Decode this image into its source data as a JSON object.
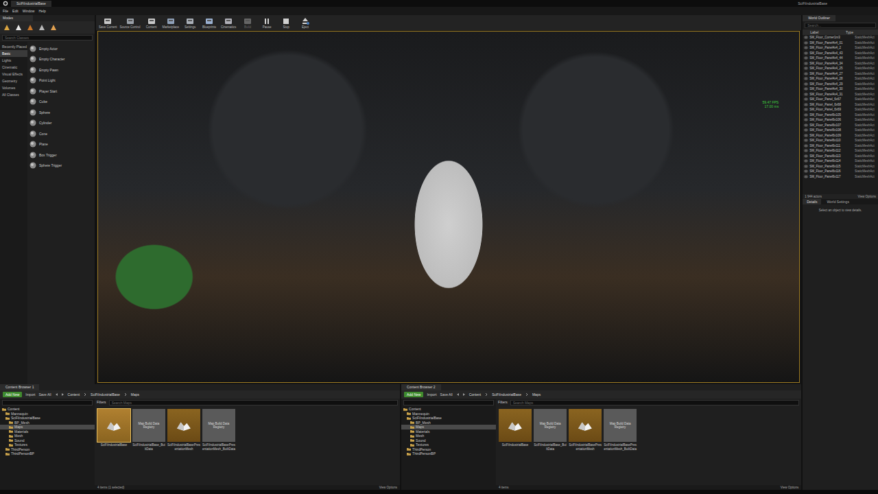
{
  "window": {
    "tab": "SciFiIndustrialBase",
    "project": "SciFiIndustrialBase"
  },
  "menu": [
    "File",
    "Edit",
    "Window",
    "Help"
  ],
  "modes": {
    "tab": "Modes",
    "search_placeholder": "Search Classes",
    "categories": [
      {
        "label": "Recently Placed",
        "selected": false
      },
      {
        "label": "Basic",
        "selected": true
      },
      {
        "label": "Lights",
        "selected": false
      },
      {
        "label": "Cinematic",
        "selected": false
      },
      {
        "label": "Visual Effects",
        "selected": false
      },
      {
        "label": "Geometry",
        "selected": false
      },
      {
        "label": "Volumes",
        "selected": false
      },
      {
        "label": "All Classes",
        "selected": false
      }
    ],
    "items": [
      "Empty Actor",
      "Empty Character",
      "Empty Pawn",
      "Point Light",
      "Player Start",
      "Cube",
      "Sphere",
      "Cylinder",
      "Cone",
      "Plane",
      "Box Trigger",
      "Sphere Trigger"
    ]
  },
  "toolbar": [
    {
      "label": "Save Current",
      "disabled": false
    },
    {
      "label": "Source Control",
      "disabled": false
    },
    {
      "label": "Content",
      "disabled": false
    },
    {
      "label": "Marketplace",
      "disabled": false
    },
    {
      "label": "Settings",
      "disabled": false
    },
    {
      "label": "Blueprints",
      "disabled": false
    },
    {
      "label": "Cinematics",
      "disabled": false
    },
    {
      "label": "Build",
      "disabled": true
    },
    {
      "label": "Pause",
      "disabled": false
    },
    {
      "label": "Stop",
      "disabled": false
    },
    {
      "label": "Eject",
      "disabled": false
    }
  ],
  "viewport": {
    "stats": [
      "59.47 FPS",
      "17.00 ms"
    ]
  },
  "outliner": {
    "tab": "World Outliner",
    "search_placeholder": "Search...",
    "columns": [
      "Label",
      "Type"
    ],
    "rows": [
      {
        "label": "SM_Floor_Corner1m3",
        "type": "StaticMeshAct"
      },
      {
        "label": "SM_Floor_Panel4x4_01",
        "type": "StaticMeshAct"
      },
      {
        "label": "SM_Floor_Panel4x4_2",
        "type": "StaticMeshAct"
      },
      {
        "label": "SM_Floor_Panel4x4_43",
        "type": "StaticMeshAct"
      },
      {
        "label": "SM_Floor_Panel4x4_44",
        "type": "StaticMeshAct"
      },
      {
        "label": "SM_Floor_Panel4x4_34",
        "type": "StaticMeshAct"
      },
      {
        "label": "SM_Floor_Panel4x4_25",
        "type": "StaticMeshAct"
      },
      {
        "label": "SM_Floor_Panel4x4_27",
        "type": "StaticMeshAct"
      },
      {
        "label": "SM_Floor_Panel4x4_28",
        "type": "StaticMeshAct"
      },
      {
        "label": "SM_Floor_Panel4x4_29",
        "type": "StaticMeshAct"
      },
      {
        "label": "SM_Floor_Panel4x4_30",
        "type": "StaticMeshAct"
      },
      {
        "label": "SM_Floor_Panel4x4_31",
        "type": "StaticMeshAct"
      },
      {
        "label": "SM_Floor_Panel_6x67",
        "type": "StaticMeshAct"
      },
      {
        "label": "SM_Floor_Panel_6x68",
        "type": "StaticMeshAct"
      },
      {
        "label": "SM_Floor_Panel_6x69",
        "type": "StaticMeshAct"
      },
      {
        "label": "SM_Floor_Panel6x105",
        "type": "StaticMeshAct"
      },
      {
        "label": "SM_Floor_Panel6x106",
        "type": "StaticMeshAct"
      },
      {
        "label": "SM_Floor_Panel6x107",
        "type": "StaticMeshAct"
      },
      {
        "label": "SM_Floor_Panel6x108",
        "type": "StaticMeshAct"
      },
      {
        "label": "SM_Floor_Panel6x109",
        "type": "StaticMeshAct"
      },
      {
        "label": "SM_Floor_Panel6x110",
        "type": "StaticMeshAct"
      },
      {
        "label": "SM_Floor_Panel6x111",
        "type": "StaticMeshAct"
      },
      {
        "label": "SM_Floor_Panel6x112",
        "type": "StaticMeshAct"
      },
      {
        "label": "SM_Floor_Panel6x113",
        "type": "StaticMeshAct"
      },
      {
        "label": "SM_Floor_Panel6x114",
        "type": "StaticMeshAct"
      },
      {
        "label": "SM_Floor_Panel6x115",
        "type": "StaticMeshAct"
      },
      {
        "label": "SM_Floor_Panel6x116",
        "type": "StaticMeshAct"
      },
      {
        "label": "SM_Floor_Panel6x117",
        "type": "StaticMeshAct"
      }
    ],
    "footer": "1 944 actors",
    "view_options": "View Options"
  },
  "details": {
    "tabs": [
      {
        "label": "Details",
        "selected": true
      },
      {
        "label": "World Settings",
        "selected": false
      }
    ],
    "empty": "Select an object to view details."
  },
  "browsers": [
    {
      "tab": "Content Browser 1",
      "add_new": "Add New",
      "import": "Import",
      "save_all": "Save All",
      "path": [
        "Content",
        "SciFiIndustrialBase",
        "Maps"
      ],
      "filters": "Filters",
      "search_placeholder": "Search Maps",
      "tree": [
        {
          "label": "Content",
          "depth": 0,
          "selected": false
        },
        {
          "label": "Mannequin",
          "depth": 1,
          "selected": false
        },
        {
          "label": "SciFiIndustrialBase",
          "depth": 1,
          "selected": false
        },
        {
          "label": "BP_Mesh",
          "depth": 2,
          "selected": false
        },
        {
          "label": "Maps",
          "depth": 2,
          "selected": true
        },
        {
          "label": "Materials",
          "depth": 2,
          "selected": false
        },
        {
          "label": "Mesh",
          "depth": 2,
          "selected": false
        },
        {
          "label": "Sound",
          "depth": 2,
          "selected": false
        },
        {
          "label": "Textures",
          "depth": 2,
          "selected": false
        },
        {
          "label": "ThirdPerson",
          "depth": 1,
          "selected": false
        },
        {
          "label": "ThirdPersonBP",
          "depth": 1,
          "selected": false
        }
      ],
      "assets": [
        {
          "label": "SciFiIndustrialBase",
          "kind": "map",
          "badge": "",
          "selected": true
        },
        {
          "label": "SciFiIndustrialBase_BuiltData",
          "kind": "registry",
          "badge": "Map Build Data Registry",
          "selected": false
        },
        {
          "label": "SciFiIndustrialBasePresentationMesh",
          "kind": "map",
          "badge": "",
          "selected": false
        },
        {
          "label": "SciFiIndustrialBasePresentationMesh_BuiltData",
          "kind": "registry",
          "badge": "Map Build Data Registry",
          "selected": false
        }
      ],
      "footer": "4 items (1 selected)",
      "view_options": "View Options"
    },
    {
      "tab": "Content Browser 2",
      "add_new": "Add New",
      "import": "Import",
      "save_all": "Save All",
      "path": [
        "Content",
        "SciFiIndustrialBase",
        "Maps"
      ],
      "filters": "Filters",
      "search_placeholder": "Search Maps",
      "tree": [
        {
          "label": "Content",
          "depth": 0,
          "selected": false
        },
        {
          "label": "Mannequin",
          "depth": 1,
          "selected": false
        },
        {
          "label": "SciFiIndustrialBase",
          "depth": 1,
          "selected": false
        },
        {
          "label": "BP_Mesh",
          "depth": 2,
          "selected": false
        },
        {
          "label": "Maps",
          "depth": 2,
          "selected": true
        },
        {
          "label": "Materials",
          "depth": 2,
          "selected": false
        },
        {
          "label": "Mesh",
          "depth": 2,
          "selected": false
        },
        {
          "label": "Sound",
          "depth": 2,
          "selected": false
        },
        {
          "label": "Textures",
          "depth": 2,
          "selected": false
        },
        {
          "label": "ThirdPerson",
          "depth": 1,
          "selected": false
        },
        {
          "label": "ThirdPersonBP",
          "depth": 1,
          "selected": false
        }
      ],
      "assets": [
        {
          "label": "SciFiIndustrialBase",
          "kind": "map",
          "badge": "",
          "selected": false
        },
        {
          "label": "SciFiIndustrialBase_BuiltData",
          "kind": "registry",
          "badge": "Map Build Data Registry",
          "selected": false
        },
        {
          "label": "SciFiIndustrialBasePresentationMesh",
          "kind": "map",
          "badge": "",
          "selected": false
        },
        {
          "label": "SciFiIndustrialBasePresentationMesh_BuiltData",
          "kind": "registry",
          "badge": "Map Build Data Registry",
          "selected": false
        }
      ],
      "footer": "4 items",
      "view_options": "View Options"
    }
  ]
}
